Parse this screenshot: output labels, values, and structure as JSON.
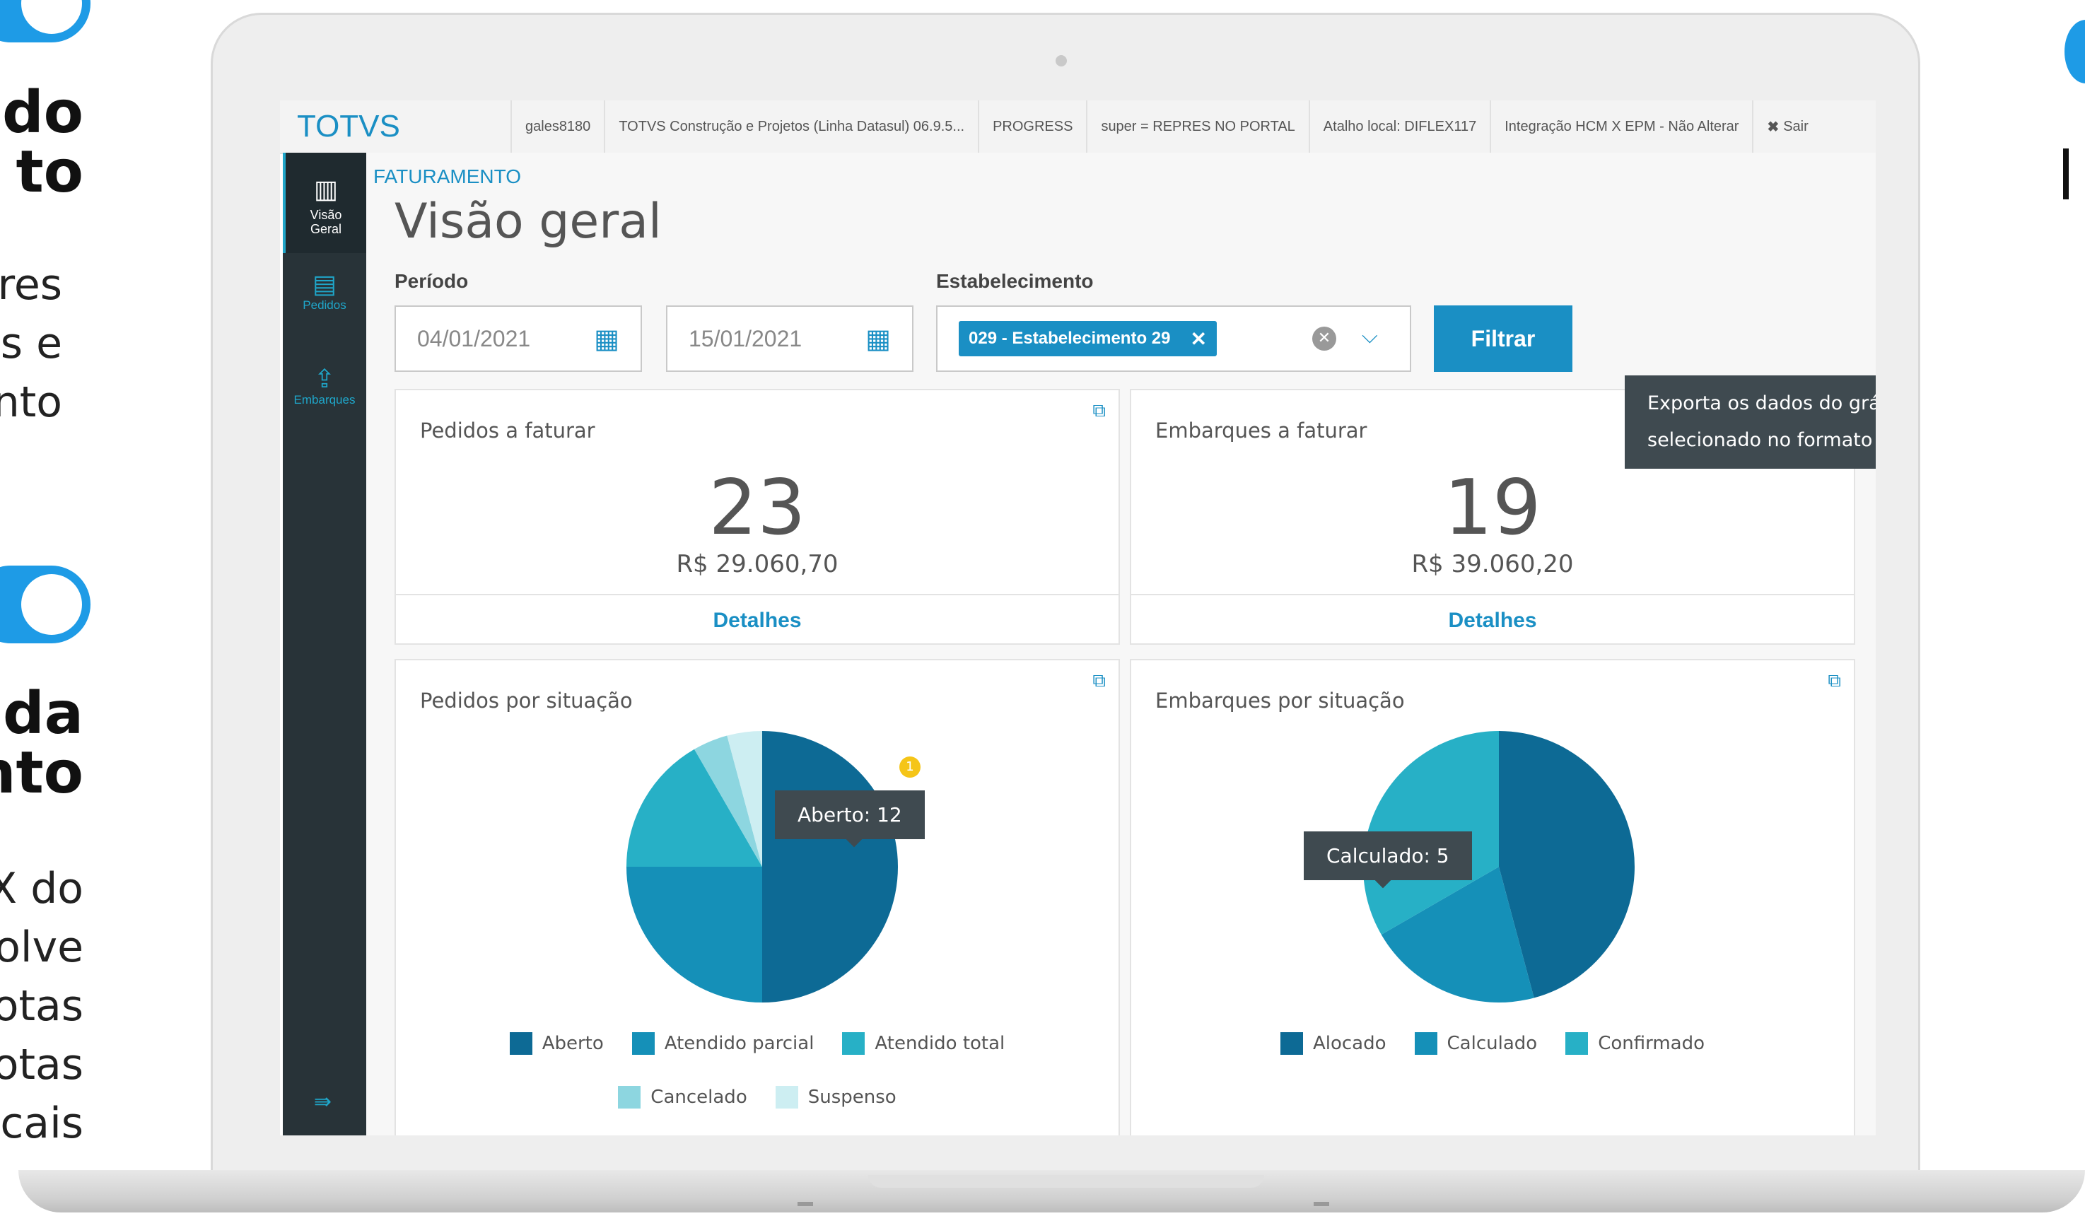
{
  "side_text": {
    "title1": [
      "do",
      "to"
    ],
    "body1": [
      "res",
      "s e",
      "nto"
    ],
    "title2": [
      "da",
      "nto"
    ],
    "body2": [
      "X do",
      "olve",
      "otas",
      "otas",
      "cais"
    ]
  },
  "header": {
    "logo": "TOTVS",
    "items": [
      "gales8180",
      "TOTVS Construção e Projetos (Linha Datasul) 06.9.5...",
      "PROGRESS",
      "super = REPRES NO PORTAL",
      "Atalho local: DIFLEX117",
      "Integração HCM X EPM - Não Alterar"
    ],
    "exit_label": "Sair"
  },
  "sidebar": {
    "items": [
      {
        "label": "Visão Geral",
        "icon": "bar-chart-icon",
        "active": true
      },
      {
        "label": "Pedidos",
        "icon": "document-icon",
        "active": false
      },
      {
        "label": "Embarques",
        "icon": "upload-file-icon",
        "active": false
      }
    ],
    "collapse_icon": "collapse-menu-icon"
  },
  "main": {
    "section": "FATURAMENTO",
    "title": "Visão geral",
    "period_label": "Período",
    "date_start": "04/01/2021",
    "date_end": "15/01/2021",
    "establishment_label": "Estabelecimento",
    "establishment_chip": "029 - Estabelecimento 29",
    "filter_button": "Filtrar",
    "csv_tooltip": "Exporta os dados do gráfico selecionado no formato .csv"
  },
  "cards": {
    "pedidos": {
      "title": "Pedidos a faturar",
      "count": "23",
      "value": "R$ 29.060,70",
      "link": "Detalhes"
    },
    "embarques": {
      "title": "Embarques a faturar",
      "count": "19",
      "value": "R$ 39.060,20",
      "link": "Detalhes"
    }
  },
  "charts": {
    "pedidos_title": "Pedidos por situação",
    "pedidos_tooltip": "Aberto: 12",
    "pedidos_badge": "1",
    "embarques_title": "Embarques por situação",
    "embarques_tooltip": "Calculado: 5"
  },
  "chart_data": [
    {
      "type": "pie",
      "title": "Pedidos por situação",
      "categories": [
        "Aberto",
        "Atendido parcial",
        "Atendido total",
        "Cancelado",
        "Suspenso"
      ],
      "values": [
        12,
        6,
        4,
        1,
        1
      ],
      "colors": [
        "#0d6a95",
        "#1590b8",
        "#27b0c6",
        "#8dd6e0",
        "#cdeef2"
      ]
    },
    {
      "type": "pie",
      "title": "Embarques por situação",
      "categories": [
        "Alocado",
        "Calculado",
        "Confirmado"
      ],
      "values": [
        11,
        5,
        8
      ],
      "colors": [
        "#0d6a95",
        "#1590b8",
        "#27b0c6"
      ]
    }
  ]
}
